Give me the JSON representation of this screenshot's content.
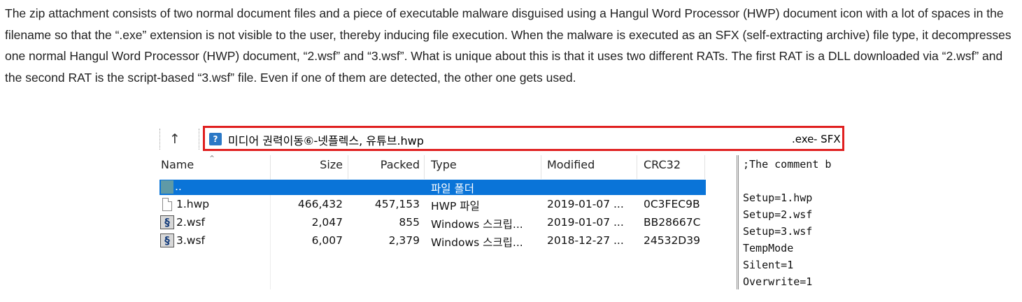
{
  "article": {
    "paragraph": "The zip attachment consists of two normal document files and a piece of executable malware disguised using a Hangul Word Processor (HWP) document icon with a lot of spaces in the filename so that the “.exe” extension is not visible to the user, thereby inducing file execution. When the malware is executed as an SFX (self-extracting archive) file type, it decompresses one normal Hangul Word Processor (HWP) document, “2.wsf” and “3.wsf”. What is unique about this is that it uses two different RATs. The first RAT is a DLL downloaded via “2.wsf” and the second RAT is the script-based “3.wsf” file. Even if one of them are detected, the other one gets used."
  },
  "window": {
    "up_icon": "arrow-up-icon",
    "address": {
      "filename": "미디어 권력이동⑥-넷플렉스, 유튜브.hwp",
      "extension": ".exe",
      "title_tail": "- SFX",
      "highlight_color": "#e02020"
    },
    "columns": [
      "Name",
      "Size",
      "Packed",
      "Type",
      "Modified",
      "CRC32"
    ],
    "parent_row": {
      "name": "..",
      "type": "파일 폴더",
      "selected_color": "#0a74d8"
    },
    "files": [
      {
        "icon": "document-icon",
        "name": "1.hwp",
        "size": "466,432",
        "packed": "457,153",
        "type": "HWP 파일",
        "modified": "2019-01-07 ...",
        "crc": "0C3FEC9B"
      },
      {
        "icon": "script-icon",
        "name": "2.wsf",
        "size": "2,047",
        "packed": "855",
        "type": "Windows 스크립...",
        "modified": "2019-01-07 ...",
        "crc": "BB28667C"
      },
      {
        "icon": "script-icon",
        "name": "3.wsf",
        "size": "6,007",
        "packed": "2,379",
        "type": "Windows 스크립...",
        "modified": "2018-12-27 ...",
        "crc": "24532D39"
      }
    ],
    "comment_pane": {
      "lines": [
        ";The comment b",
        "",
        "Setup=1.hwp",
        "Setup=2.wsf",
        "Setup=3.wsf",
        "TempMode",
        "Silent=1",
        "Overwrite=1"
      ]
    }
  }
}
